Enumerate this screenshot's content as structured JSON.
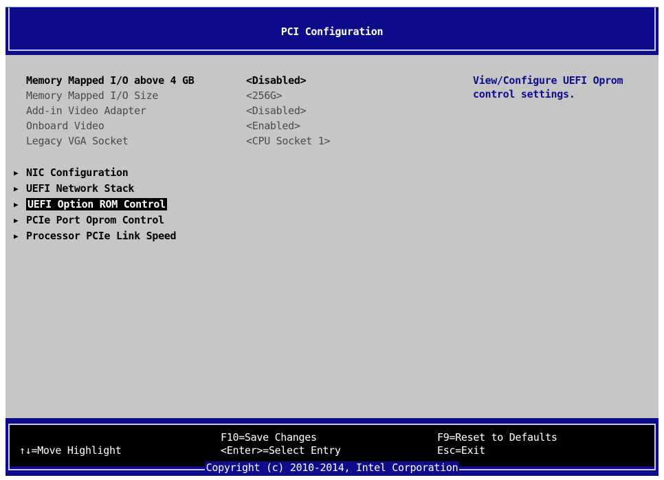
{
  "header": {
    "title": "PCI Configuration"
  },
  "settings": [
    {
      "label": "Memory Mapped I/O above 4 GB",
      "value": "<Disabled>"
    },
    {
      "label": "Memory Mapped I/O Size",
      "value": "<256G>"
    },
    {
      "label": "Add-in Video Adapter",
      "value": "<Disabled>"
    },
    {
      "label": "Onboard Video",
      "value": "<Enabled>"
    },
    {
      "label": "Legacy VGA Socket",
      "value": "<CPU Socket 1>"
    }
  ],
  "submenus": [
    {
      "label": "NIC Configuration"
    },
    {
      "label": "UEFI Network Stack"
    },
    {
      "label": "UEFI Option ROM Control",
      "selected": true
    },
    {
      "label": "PCIe Port Oprom Control"
    },
    {
      "label": "Processor PCIe Link Speed"
    }
  ],
  "submenu_icon": "right-triangle-arrow-icon",
  "help": {
    "text": "View/Configure UEFI Oprom\ncontrol settings."
  },
  "footer": {
    "move_highlight": "↑↓=Move Highlight",
    "save_changes": "F10=Save Changes",
    "select_entry": "<Enter>=Select Entry",
    "reset_defaults": "F9=Reset to Defaults",
    "exit": "Esc=Exit",
    "copyright": "Copyright (c) 2010-2014, Intel Corporation"
  },
  "colors": {
    "bar_blue": "#0d0d8c",
    "panel_gray": "#c6c6c6",
    "help_text": "#0d0d8c",
    "highlight_bg": "#000000"
  }
}
